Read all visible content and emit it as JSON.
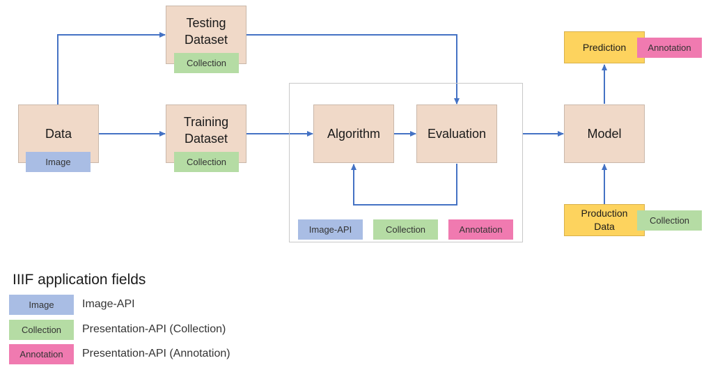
{
  "nodes": {
    "data": {
      "label": "Data",
      "tag": "Image"
    },
    "testing": {
      "line1": "Testing",
      "line2": "Dataset",
      "tag": "Collection"
    },
    "training": {
      "line1": "Training",
      "line2": "Dataset",
      "tag": "Collection"
    },
    "algorithm": {
      "label": "Algorithm"
    },
    "evaluation": {
      "label": "Evaluation"
    },
    "model": {
      "label": "Model"
    },
    "prediction": {
      "label": "Prediction",
      "tag": "Annotation"
    },
    "production": {
      "line1": "Production",
      "line2": "Data",
      "tag": "Collection"
    }
  },
  "group_tags": [
    "Image-API",
    "Collection",
    "Annotation"
  ],
  "legend": {
    "title": "IIIF application fields",
    "items": [
      {
        "swatch": "Image",
        "description": "Image-API",
        "color": "#a9bde4"
      },
      {
        "swatch": "Collection",
        "description": "Presentation-API (Collection)",
        "color": "#b5dca4"
      },
      {
        "swatch": "Annotation",
        "description": "Presentation-API (Annotation)",
        "color": "#f07ab0"
      }
    ]
  },
  "colors": {
    "process": "#f0d9c8",
    "output": "#fdd35e",
    "arrow": "#4472c4"
  }
}
